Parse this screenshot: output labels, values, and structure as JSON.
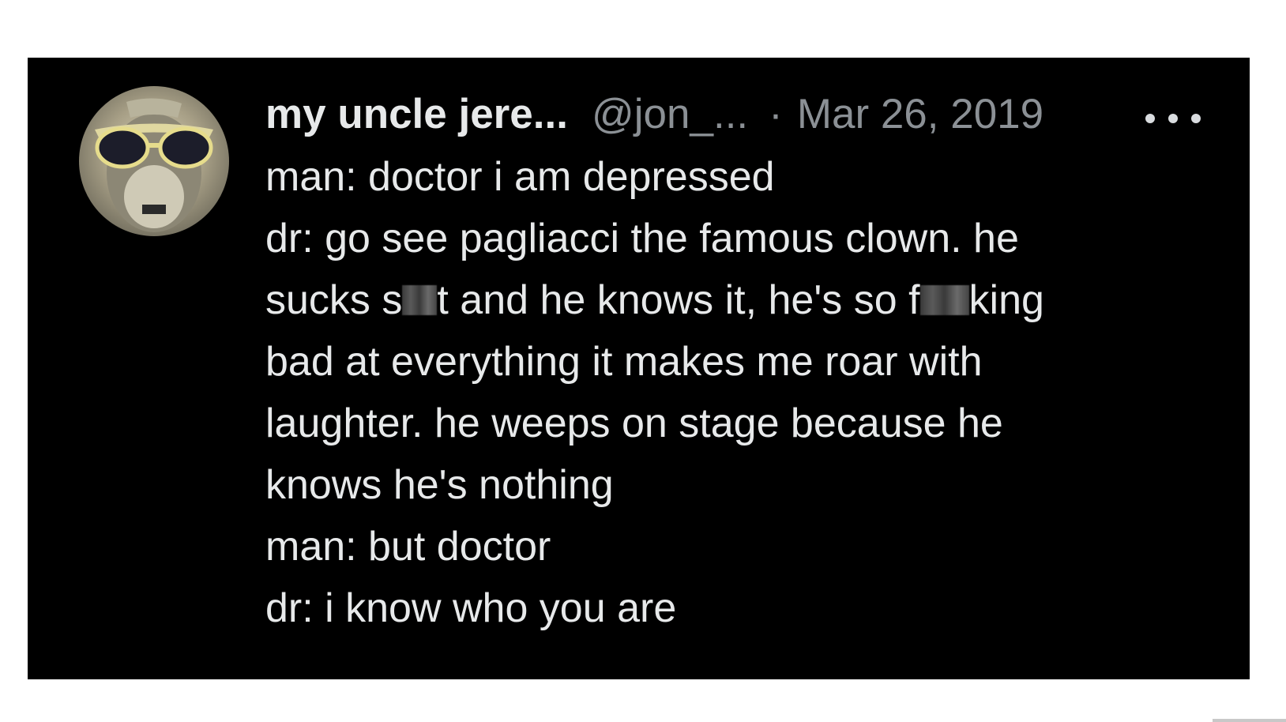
{
  "tweet": {
    "display_name": "my uncle jere...",
    "handle": "@jon_...",
    "separator": "·",
    "timestamp": "Mar 26, 2019",
    "lines": {
      "l1": "man: doctor i am depressed",
      "l2": "dr: go see pagliacci the famous clown. he",
      "l3a": "sucks s",
      "l3b": "t and he knows it, he's so f",
      "l3c": "king",
      "l4": "bad at everything it makes me roar with",
      "l5": "laughter. he weeps on stage because he",
      "l6": "knows he's nothing",
      "l7": "man: but doctor",
      "l8": "dr: i know who you are"
    }
  },
  "icons": {
    "avatar": "avatar-image",
    "more": "more-options-icon"
  },
  "colors": {
    "card_background": "#000000",
    "primary_text": "#e7e9ea",
    "secondary_text": "#8b9095",
    "page_background": "#ffffff"
  }
}
